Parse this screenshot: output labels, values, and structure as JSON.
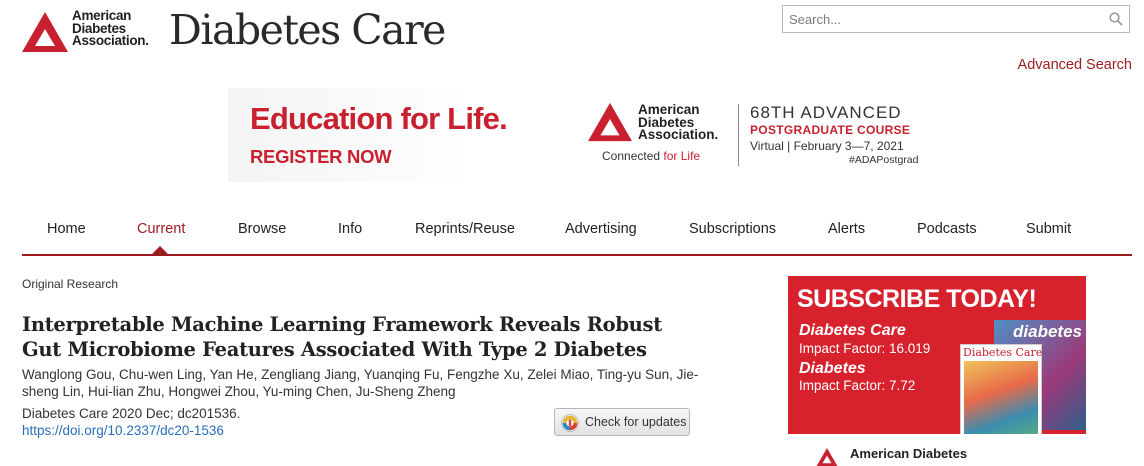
{
  "header": {
    "logo_org_lines": [
      "American",
      "Diabetes",
      "Association."
    ],
    "journal_title": "Diabetes Care",
    "search_placeholder": "Search...",
    "advanced_search": "Advanced Search"
  },
  "banner": {
    "headline": "Education for Life.",
    "cta": "REGISTER NOW",
    "org_lines": [
      "American",
      "Diabetes",
      "Association."
    ],
    "connected_prefix": "Connected ",
    "connected_accent": "for Life",
    "event_title": "68TH ADVANCED",
    "event_subtitle": "POSTGRADUATE COURSE",
    "event_dates": "Virtual  |  February 3—7, 2021",
    "hashtag": "#ADAPostgrad"
  },
  "nav": {
    "items": [
      "Home",
      "Current",
      "Browse",
      "Info",
      "Reprints/Reuse",
      "Advertising",
      "Subscriptions",
      "Alerts",
      "Podcasts",
      "Submit"
    ],
    "active": "Current"
  },
  "article": {
    "section": "Original Research",
    "title": "Interpretable Machine Learning Framework Reveals Robust Gut Microbiome Features Associated With Type 2 Diabetes",
    "authors": "Wanglong Gou, Chu-wen Ling, Yan He, Zengliang Jiang, Yuanqing Fu, Fengzhe Xu, Zelei Miao, Ting-yu Sun, Jie-sheng Lin, Hui-lian Zhu, Hongwei Zhou, Yu-ming Chen, Ju-Sheng Zheng",
    "citation": "Diabetes Care 2020 Dec; dc201536.",
    "doi": "https://doi.org/10.2337/dc20-1536",
    "check_updates": "Check for updates"
  },
  "sidebar_ad": {
    "headline": "SUBSCRIBE TODAY!",
    "journal1": "Diabetes Care",
    "impact1": "Impact Factor: 16.019",
    "journal2": "Diabetes",
    "impact2": "Impact Factor: 7.72",
    "cover_back_title": "diabetes",
    "cover_front_title": "Diabetes Care",
    "footer_org": "American Diabetes"
  },
  "colors": {
    "brand_red": "#9d1b1f",
    "banner_red": "#c8202f",
    "link_blue": "#2a6ebb"
  }
}
